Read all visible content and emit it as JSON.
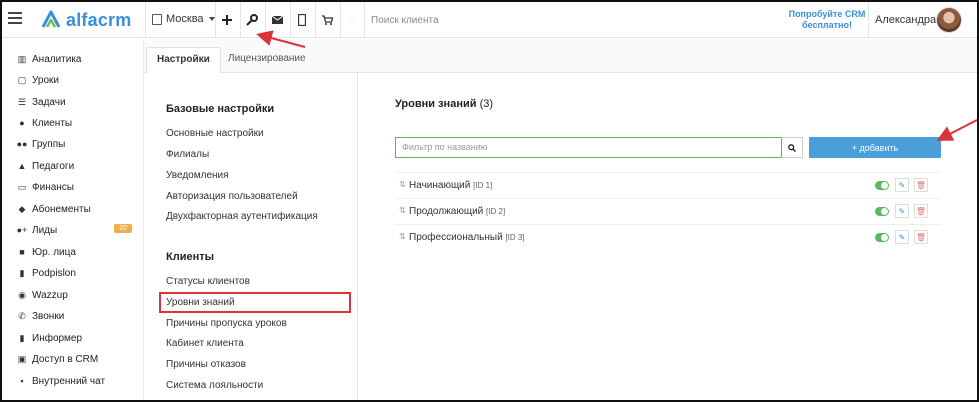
{
  "topbar": {
    "logo_text": "alfacrm",
    "city": "Москва",
    "search_placeholder": "Поиск клиента",
    "promo": "Попробуйте CRM бесплатно!",
    "user_name": "Александра"
  },
  "sidebar": {
    "items": [
      {
        "label": "Аналитика",
        "icon": "chart-icon"
      },
      {
        "label": "Уроки",
        "icon": "calendar-icon"
      },
      {
        "label": "Задачи",
        "icon": "tasks-icon"
      },
      {
        "label": "Клиенты",
        "icon": "user-icon"
      },
      {
        "label": "Группы",
        "icon": "group-icon"
      },
      {
        "label": "Педагоги",
        "icon": "graduation-cap-icon"
      },
      {
        "label": "Финансы",
        "icon": "money-icon"
      },
      {
        "label": "Абонементы",
        "icon": "tag-icon"
      },
      {
        "label": "Лиды",
        "icon": "add-user-icon",
        "badge": "20"
      },
      {
        "label": "Юр. лица",
        "icon": "briefcase-icon"
      },
      {
        "label": "Podpislon",
        "icon": "document-icon"
      },
      {
        "label": "Wazzup",
        "icon": "whatsapp-icon"
      },
      {
        "label": "Звонки",
        "icon": "phone-icon"
      },
      {
        "label": "Информер",
        "icon": "book-icon"
      },
      {
        "label": "Доступ в CRM",
        "icon": "lock-icon"
      },
      {
        "label": "Внутренний чат",
        "icon": "chat-icon"
      }
    ]
  },
  "tabs": [
    {
      "label": "Настройки",
      "active": true
    },
    {
      "label": "Лицензирование",
      "active": false
    }
  ],
  "settings": {
    "basic_title": "Базовые настройки",
    "basic_items": [
      "Основные настройки",
      "Филиалы",
      "Уведомления",
      "Авторизация пользователей",
      "Двухфакторная аутентификация"
    ],
    "clients_title": "Клиенты",
    "client_items": [
      "Статусы клиентов",
      "Уровни знаний",
      "Причины пропуска уроков",
      "Кабинет клиента",
      "Причины отказов",
      "Система лояльности"
    ]
  },
  "content": {
    "title": "Уровни знаний",
    "count": "(3)",
    "filter_placeholder": "Фильтр по названию",
    "add_button": "+ добавить",
    "rows": [
      {
        "name": "Начинающий",
        "id": "[ID 1]",
        "enabled": true
      },
      {
        "name": "Продолжающий",
        "id": "[ID 2]",
        "enabled": true
      },
      {
        "name": "Профессиональный",
        "id": "[ID 3]",
        "enabled": true
      }
    ]
  },
  "colors": {
    "accent": "#4a9fd8",
    "toggle_on": "#5cb85c",
    "highlight": "#d9343a",
    "badge": "#f0ad4e"
  }
}
